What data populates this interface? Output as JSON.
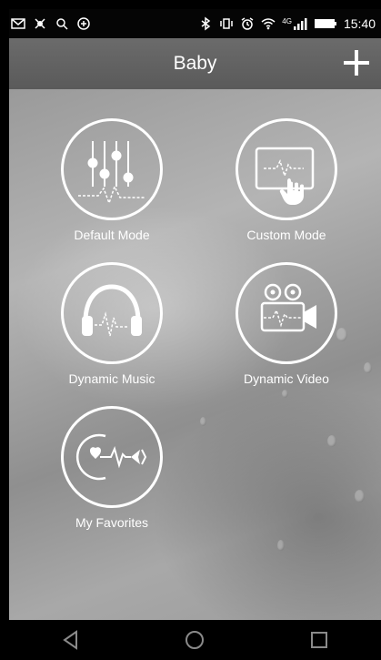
{
  "status_bar": {
    "time": "15:40",
    "network_label": "4G"
  },
  "app_bar": {
    "title": "Baby",
    "add_icon": "plus-icon"
  },
  "modes": [
    {
      "label": "Default Mode",
      "icon": "equalizer-sliders-icon"
    },
    {
      "label": "Custom Mode",
      "icon": "touch-screen-icon"
    },
    {
      "label": "Dynamic Music",
      "icon": "headphones-icon"
    },
    {
      "label": "Dynamic Video",
      "icon": "video-camera-icon"
    },
    {
      "label": "My Favorites",
      "icon": "heart-arrow-icon"
    }
  ],
  "nav_bar": {
    "back_icon": "back-triangle-icon",
    "home_icon": "home-circle-icon",
    "recents_icon": "recents-square-icon"
  },
  "colors": {
    "status_bar": "#050505",
    "app_bar": "#616161",
    "foreground": "#ffffff"
  }
}
